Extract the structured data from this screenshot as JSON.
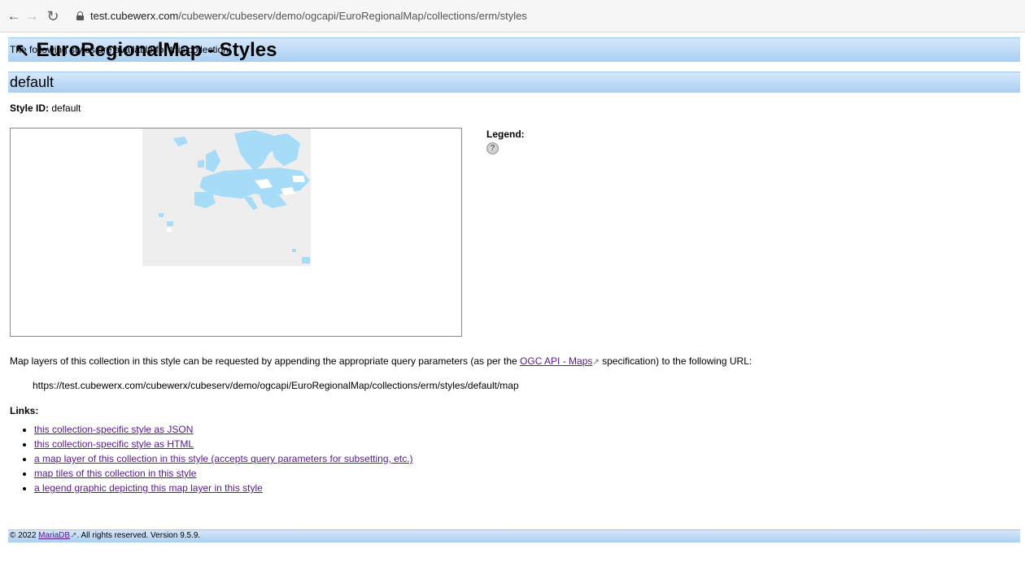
{
  "browser": {
    "url_host": "test.cubewerx.com",
    "url_path": "/cubewerx/cubeserv/demo/ogcapi/EuroRegionalMap/collections/erm/styles",
    "back_icon": "back-arrow-icon",
    "forward_icon": "forward-arrow-icon",
    "reload_icon": "reload-icon",
    "lock_icon": "lock-icon"
  },
  "header": {
    "back_arrow": "↖",
    "title": "EuroRegionalMap - Styles"
  },
  "intro": "The following styles are available for this collection:",
  "style": {
    "name": "default",
    "id_label": "Style ID:",
    "id_value": "default",
    "legend_label": "Legend:",
    "legend_icon": "?"
  },
  "map_description": {
    "before": "Map layers of this collection in this style can be requested by appending the appropriate query parameters (as per the ",
    "link": "OGC API - Maps",
    "after": " specification) to the following URL:"
  },
  "map_url": "https://test.cubewerx.com/cubewerx/cubeserv/demo/ogcapi/EuroRegionalMap/collections/erm/styles/default/map",
  "links_heading": "Links:",
  "links": [
    "this collection-specific style as JSON",
    "this collection-specific style as HTML",
    "a map layer of this collection in this style (accepts query parameters for subsetting, etc.)",
    "map tiles of this collection in this style",
    "a legend graphic depicting this map layer in this style"
  ],
  "footer": {
    "prefix": "© 2022 ",
    "link": "MariaDB",
    "suffix": ". All rights reserved. Version 9.5.9."
  },
  "colors": {
    "header_bar_top": "#d6e8fb",
    "header_bar_bottom": "#a9cff2",
    "link": "#551a8b",
    "map_land": "#a6dcf8",
    "map_bg": "#f0f0f0"
  }
}
